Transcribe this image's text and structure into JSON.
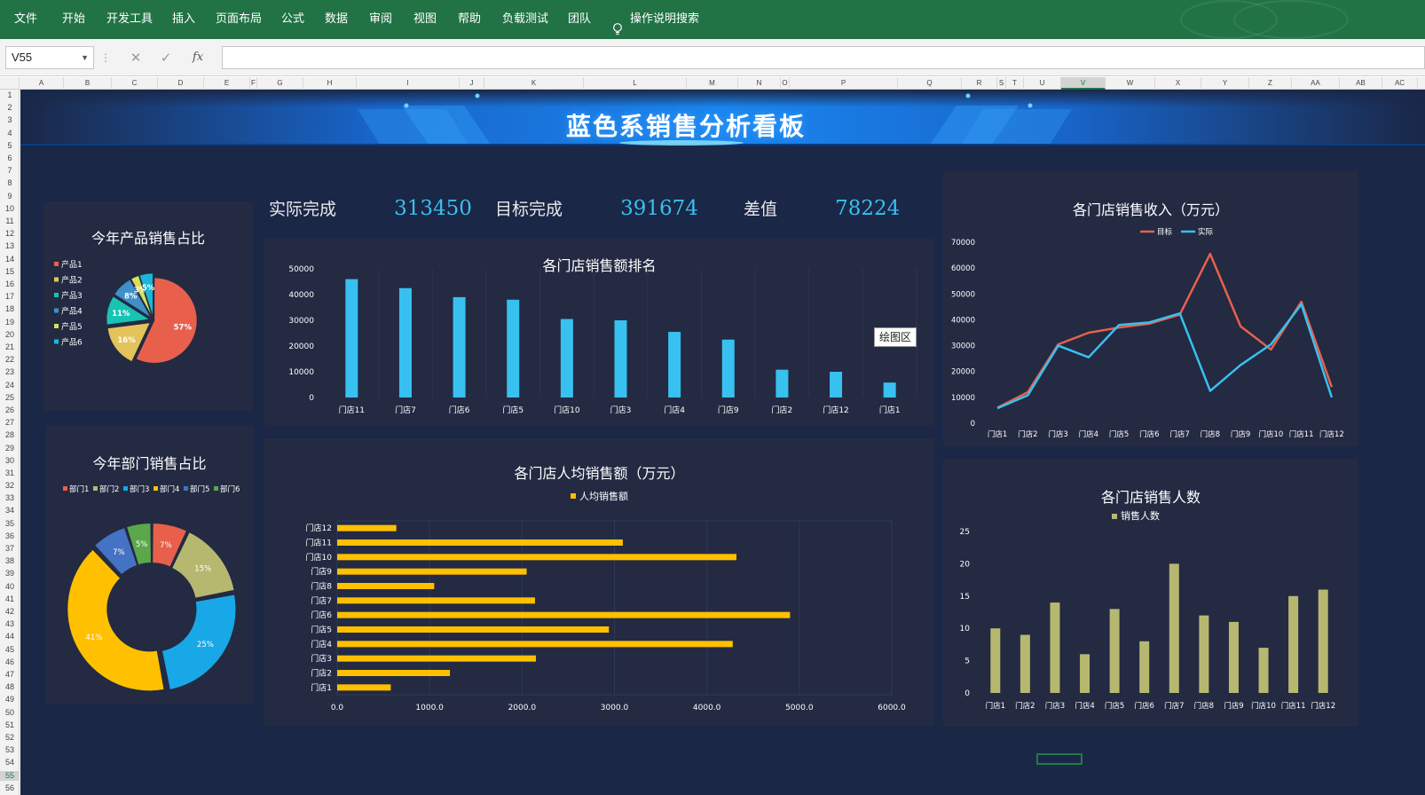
{
  "ribbon": {
    "tabs": [
      "文件",
      "开始",
      "开发工具",
      "插入",
      "页面布局",
      "公式",
      "数据",
      "审阅",
      "视图",
      "帮助",
      "负载测试",
      "团队"
    ],
    "search_label": "操作说明搜索",
    "bg_color": "#217346"
  },
  "formula_bar": {
    "name_box": "V55",
    "cancel_icon": "✕",
    "enter_icon": "✓",
    "fx_label": "fx",
    "formula": ""
  },
  "grid": {
    "columns": [
      "A",
      "B",
      "C",
      "D",
      "E",
      "F",
      "G",
      "H",
      "I",
      "J",
      "K",
      "L",
      "M",
      "N",
      "O",
      "P",
      "Q",
      "R",
      "S",
      "T",
      "U",
      "V",
      "W",
      "X",
      "Y",
      "Z",
      "AA",
      "AB",
      "AC"
    ],
    "selected_column": "V",
    "rows": [
      "1",
      "2",
      "3",
      "4",
      "5",
      "6",
      "7",
      "8",
      "9",
      "10",
      "11",
      "12",
      "13",
      "14",
      "15",
      "16",
      "17",
      "18",
      "19",
      "20",
      "21",
      "22",
      "23",
      "24",
      "25",
      "26",
      "27",
      "28",
      "29",
      "30",
      "31",
      "32",
      "33",
      "34",
      "35",
      "36",
      "37",
      "38",
      "39",
      "40",
      "41",
      "42",
      "43",
      "44",
      "45",
      "46",
      "47",
      "48",
      "49",
      "50",
      "51",
      "52",
      "53",
      "54",
      "55",
      "56"
    ],
    "selected_row": "55"
  },
  "dashboard": {
    "title": "蓝色系销售分析看板",
    "bg_color": "#1a2747",
    "panel_color": "#232a42",
    "kpis": [
      {
        "label": "实际完成",
        "value": "313450"
      },
      {
        "label": "目标完成",
        "value": "391674"
      },
      {
        "label": "差值",
        "value": "78224"
      }
    ],
    "tooltip": "绘图区"
  },
  "chart_data": [
    {
      "id": "product_pie",
      "type": "pie",
      "title": "今年产品销售占比",
      "categories": [
        "产品1",
        "产品2",
        "产品3",
        "产品4",
        "产品5",
        "产品6"
      ],
      "values": [
        57,
        16,
        11,
        8,
        3,
        5
      ],
      "labels": [
        "57%",
        "16%",
        "11%",
        "8%",
        "3%",
        "5%"
      ],
      "colors": [
        "#e8604c",
        "#e3c35a",
        "#18c3b3",
        "#3f8fc8",
        "#d8e05a",
        "#18b8d8"
      ],
      "legend": "left"
    },
    {
      "id": "dept_donut",
      "type": "pie",
      "title": "今年部门销售占比",
      "categories": [
        "部门1",
        "部门2",
        "部门3",
        "部门4",
        "部门5",
        "部门6"
      ],
      "values": [
        7,
        15,
        25,
        41,
        7,
        5
      ],
      "labels": [
        "7%",
        "15%",
        "25%",
        "41%",
        "7%",
        "5%"
      ],
      "colors": [
        "#e8604c",
        "#b6b870",
        "#18a8e8",
        "#ffc000",
        "#4472c4",
        "#5aa84a"
      ],
      "legend": "top"
    },
    {
      "id": "store_rank",
      "type": "bar",
      "title": "各门店销售额排名",
      "categories": [
        "门店11",
        "门店7",
        "门店6",
        "门店5",
        "门店10",
        "门店3",
        "门店4",
        "门店9",
        "门店2",
        "门店12",
        "门店1"
      ],
      "values": [
        46000,
        42500,
        39000,
        38000,
        30500,
        30000,
        25500,
        22500,
        10800,
        10000,
        5800
      ],
      "ylim": [
        0,
        50000
      ],
      "yticks": [
        "0",
        "10000",
        "20000",
        "30000",
        "40000",
        "50000"
      ],
      "color": "#38c0f0"
    },
    {
      "id": "store_avg",
      "type": "bar",
      "orientation": "horizontal",
      "title": "各门店人均销售额（万元）",
      "series_name": "人均销售额",
      "categories": [
        "门店1",
        "门店2",
        "门店3",
        "门店4",
        "门店5",
        "门店6",
        "门店7",
        "门店8",
        "门店9",
        "门店10",
        "门店11",
        "门店12"
      ],
      "values": [
        580,
        1220,
        2150,
        4280,
        2940,
        4900,
        2140,
        1050,
        2050,
        4320,
        3090,
        640
      ],
      "xlim": [
        0,
        6000
      ],
      "xticks": [
        "0.0",
        "1000.0",
        "2000.0",
        "3000.0",
        "4000.0",
        "5000.0",
        "6000.0"
      ],
      "color": "#ffc000"
    },
    {
      "id": "store_income",
      "type": "line",
      "title": "各门店销售收入（万元）",
      "categories": [
        "门店1",
        "门店2",
        "门店3",
        "门店4",
        "门店5",
        "门店6",
        "门店7",
        "门店8",
        "门店9",
        "门店10",
        "门店11",
        "门店12"
      ],
      "series": [
        {
          "name": "目标",
          "values": [
            6000,
            12000,
            30500,
            35000,
            37000,
            38500,
            42000,
            65500,
            37500,
            28500,
            47000,
            14000
          ],
          "color": "#e8604c"
        },
        {
          "name": "实际",
          "values": [
            5800,
            10800,
            30000,
            25500,
            38000,
            39000,
            42500,
            12500,
            22500,
            30500,
            46000,
            10000
          ],
          "color": "#38c0f0"
        }
      ],
      "ylim": [
        0,
        70000
      ],
      "yticks": [
        "0",
        "10000",
        "20000",
        "30000",
        "40000",
        "50000",
        "60000",
        "70000"
      ],
      "legend": "top"
    },
    {
      "id": "store_staff",
      "type": "bar",
      "title": "各门店销售人数",
      "series_name": "销售人数",
      "categories": [
        "门店1",
        "门店2",
        "门店3",
        "门店4",
        "门店5",
        "门店6",
        "门店7",
        "门店8",
        "门店9",
        "门店10",
        "门店11",
        "门店12"
      ],
      "values": [
        10,
        9,
        14,
        6,
        13,
        8,
        20,
        12,
        11,
        7,
        15,
        16
      ],
      "ylim": [
        0,
        25
      ],
      "yticks": [
        "0",
        "5",
        "10",
        "15",
        "20",
        "25"
      ],
      "color": "#b6b870"
    }
  ]
}
